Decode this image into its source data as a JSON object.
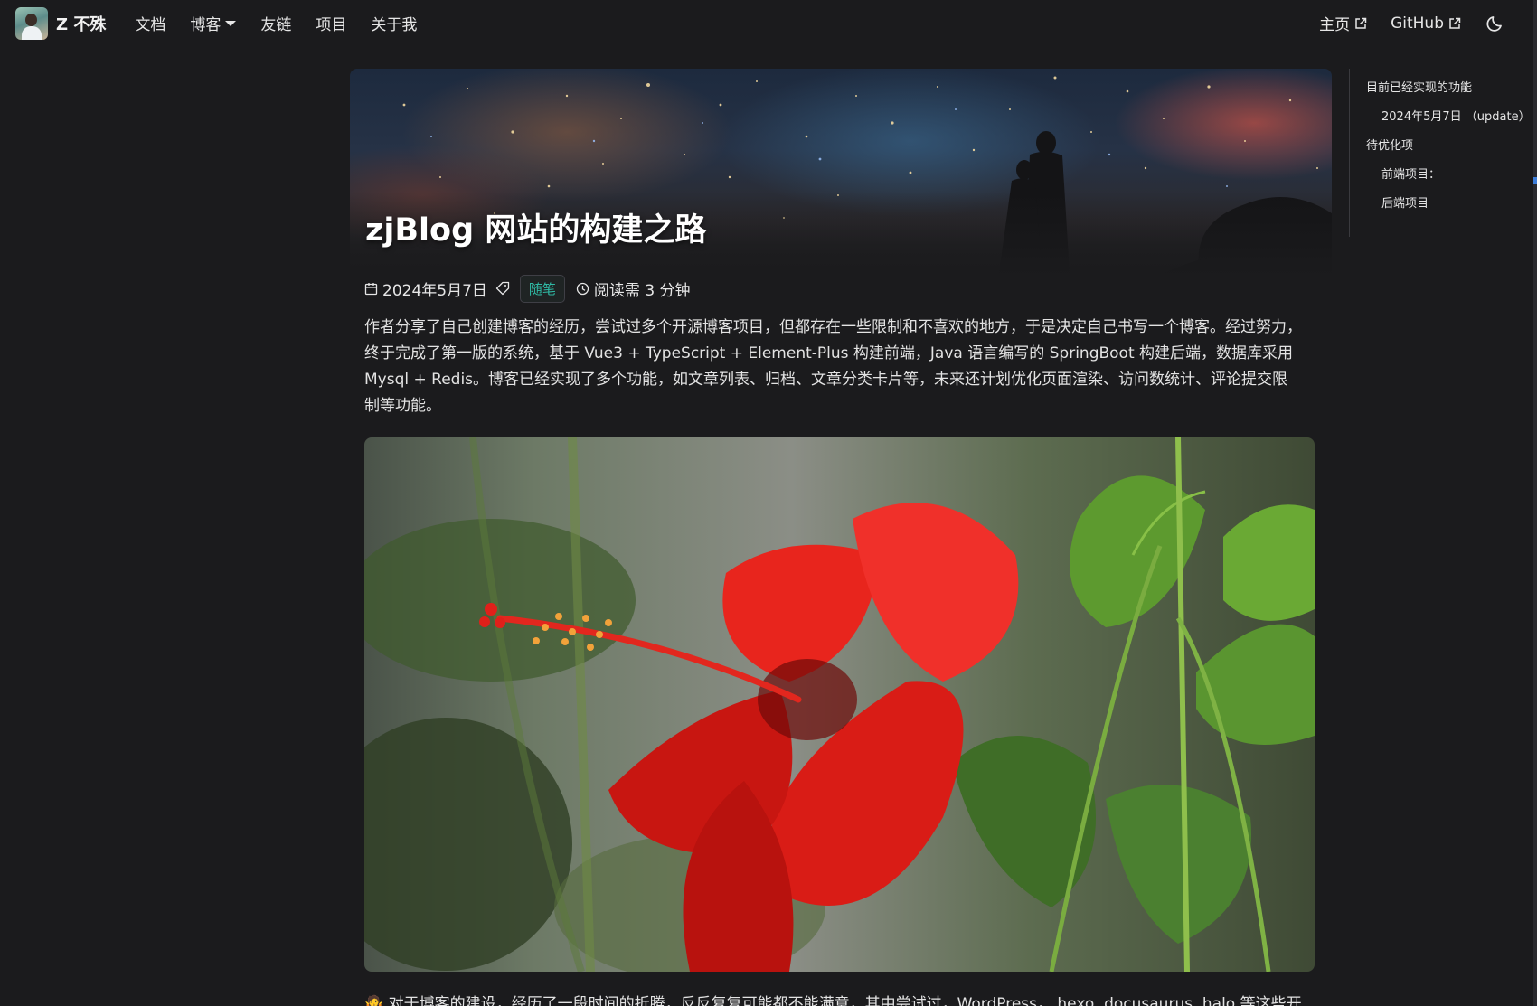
{
  "navbar": {
    "brand": "Z 不殊",
    "links": [
      "文档",
      "博客",
      "友链",
      "项目",
      "关于我"
    ],
    "external": [
      "主页",
      "GitHub"
    ],
    "theme_toggle_icon": "moon-icon"
  },
  "article": {
    "title": "zjBlog 网站的构建之路",
    "date": "2024年5月7日",
    "tag": "随笔",
    "read_time": "阅读需 3 分钟",
    "summary": "作者分享了自己创建博客的经历，尝试过多个开源博客项目，但都存在一些限制和不喜欢的地方，于是决定自己书写一个博客。经过努力，终于完成了第一版的系统，基于 Vue3 + TypeScript + Element-Plus 构建前端，Java 语言编写的 SpringBoot 构建后端，数据库采用 Mysql + Redis。博客已经实现了多个功能，如文章列表、归档、文章分类卡片等，未来还计划优化页面渲染、访问数统计、评论提交限制等功能。",
    "body_first_line": "🤷 对于博客的建设，经历了一段时间的折腾，反反复复可能都不能满意，其中尝试过，WordPress， hexo, docusaurus, halo 等这些开"
  },
  "toc": {
    "items": [
      {
        "label": "目前已经实现的功能",
        "level": 1
      },
      {
        "label": "2024年5月7日 （update）",
        "level": 2
      },
      {
        "label": "待优化项",
        "level": 1
      },
      {
        "label": "前端项目：",
        "level": 2
      },
      {
        "label": "后端项目",
        "level": 2
      }
    ]
  },
  "colors": {
    "background": "#1b1b1d",
    "tag_text": "#2fb9a4",
    "text": "#e3e3e3"
  }
}
